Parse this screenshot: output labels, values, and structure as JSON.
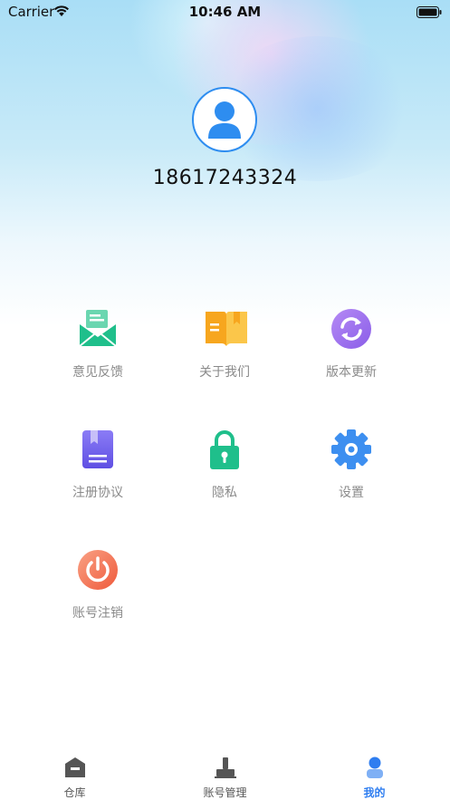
{
  "status_bar": {
    "carrier": "Carrier",
    "time": "10:46 AM"
  },
  "profile": {
    "phone": "18617243324"
  },
  "menu": [
    {
      "label": "意见反馈",
      "icon": "mail-icon",
      "color": "#20c490"
    },
    {
      "label": "关于我们",
      "icon": "book-icon",
      "color": "#f5a623"
    },
    {
      "label": "版本更新",
      "icon": "refresh-icon",
      "color": "#9b6ef0"
    },
    {
      "label": "注册协议",
      "icon": "document-icon",
      "color": "#7a6df0"
    },
    {
      "label": "隐私",
      "icon": "lock-icon",
      "color": "#20c490"
    },
    {
      "label": "设置",
      "icon": "gear-icon",
      "color": "#3d8ff0"
    },
    {
      "label": "账号注销",
      "icon": "power-icon",
      "color": "#f26b4e"
    }
  ],
  "tabs": [
    {
      "label": "仓库",
      "icon": "warehouse-icon"
    },
    {
      "label": "账号管理",
      "icon": "stamp-icon"
    },
    {
      "label": "我的",
      "icon": "user-icon",
      "active": true
    }
  ],
  "colors": {
    "accent": "#2e7df0",
    "label_gray": "#8a8a8a"
  }
}
